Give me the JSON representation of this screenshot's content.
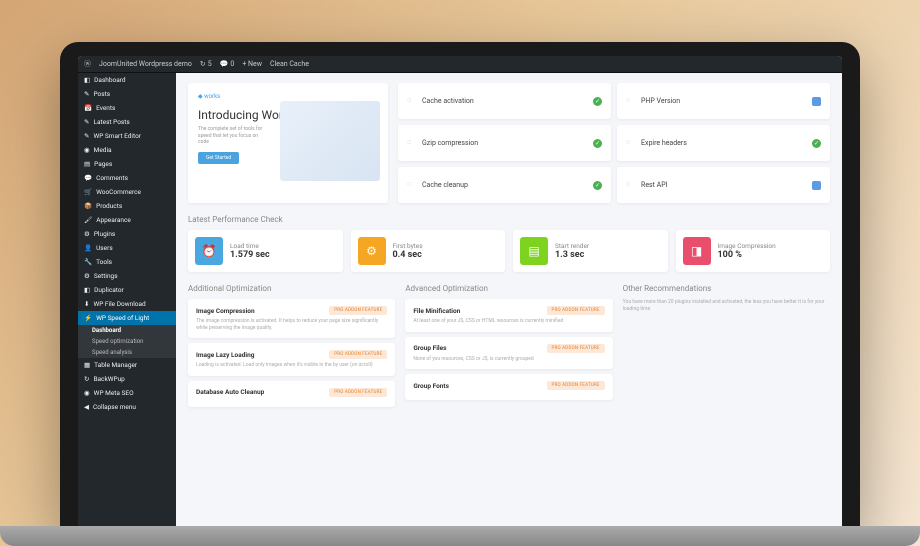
{
  "toolbar": {
    "site": "JoomUnited Wordpress demo",
    "updates": "5",
    "comments": "0",
    "new": "+ New",
    "cache": "Clean Cache"
  },
  "sidebar": {
    "items": [
      {
        "icon": "◧",
        "label": "Dashboard"
      },
      {
        "icon": "✎",
        "label": "Posts"
      },
      {
        "icon": "📅",
        "label": "Events"
      },
      {
        "icon": "✎",
        "label": "Latest Posts"
      },
      {
        "icon": "✎",
        "label": "WP Smart Editor"
      },
      {
        "icon": "◉",
        "label": "Media"
      },
      {
        "icon": "▤",
        "label": "Pages"
      },
      {
        "icon": "💬",
        "label": "Comments"
      },
      {
        "icon": "🛒",
        "label": "WooCommerce"
      },
      {
        "icon": "📦",
        "label": "Products"
      },
      {
        "icon": "🖌",
        "label": "Appearance"
      },
      {
        "icon": "⚙",
        "label": "Plugins"
      },
      {
        "icon": "👤",
        "label": "Users"
      },
      {
        "icon": "🔧",
        "label": "Tools"
      },
      {
        "icon": "⚙",
        "label": "Settings"
      },
      {
        "icon": "◧",
        "label": "Duplicator"
      },
      {
        "icon": "⬇",
        "label": "WP File Download"
      },
      {
        "icon": "⚡",
        "label": "WP Speed of Light",
        "active": true
      },
      {
        "icon": "▦",
        "label": "Table Manager"
      },
      {
        "icon": "↻",
        "label": "BackWPup"
      },
      {
        "icon": "◉",
        "label": "WP Meta SEO"
      },
      {
        "icon": "◀",
        "label": "Collapse menu"
      }
    ],
    "subs": [
      {
        "label": "Dashboard",
        "current": true
      },
      {
        "label": "Speed optimization"
      },
      {
        "label": "Speed analysis"
      }
    ]
  },
  "intro": {
    "brand": "works",
    "title": "Introducing Works",
    "subtitle": "The complete set of tools for speed that let you focus on code",
    "button": "Get Started"
  },
  "status": [
    {
      "label": "Cache activation",
      "ok": true,
      "right": "green"
    },
    {
      "label": "PHP Version",
      "ok": true,
      "right": "blue"
    },
    {
      "label": "Gzip compression",
      "ok": true,
      "right": "green"
    },
    {
      "label": "Expire headers",
      "ok": true,
      "right": "green"
    },
    {
      "label": "Cache cleanup",
      "ok": true,
      "right": "green"
    },
    {
      "label": "Rest API",
      "ok": true,
      "right": "blue"
    }
  ],
  "perf": {
    "title": "Latest Performance Check",
    "metrics": [
      {
        "label": "Load time",
        "value": "1.579 sec",
        "color": "bg-blue",
        "icon": "⏰"
      },
      {
        "label": "First bytes",
        "value": "0.4 sec",
        "color": "bg-orange",
        "icon": "⚙"
      },
      {
        "label": "Start render",
        "value": "1.3 sec",
        "color": "bg-green",
        "icon": "▤"
      },
      {
        "label": "Image Compression",
        "value": "100 %",
        "color": "bg-red",
        "icon": "◨"
      }
    ]
  },
  "badge": "PRO ADDON FEATURE",
  "additional": {
    "title": "Additional Optimization",
    "items": [
      {
        "name": "Image Compression",
        "desc": "The image compression is activated. It helps to reduce your page size significantly while preserving the image quality."
      },
      {
        "name": "Image Lazy Loading",
        "desc": "Loading is activated. Load only images when it's visible in the by user (on scroll)"
      },
      {
        "name": "Database Auto Cleanup",
        "desc": ""
      }
    ]
  },
  "advanced": {
    "title": "Advanced Optimization",
    "items": [
      {
        "name": "File Minification",
        "desc": "At least one of your JS, CSS or HTML resources is currently minified"
      },
      {
        "name": "Group Files",
        "desc": "None of you resources, CSS or JS, is currently grouped"
      },
      {
        "name": "Group Fonts",
        "desc": ""
      }
    ]
  },
  "rec": {
    "title": "Other Recommendations",
    "text": "You have more than 20 plugins installed and activated, the less you have better it is for your loading time"
  }
}
